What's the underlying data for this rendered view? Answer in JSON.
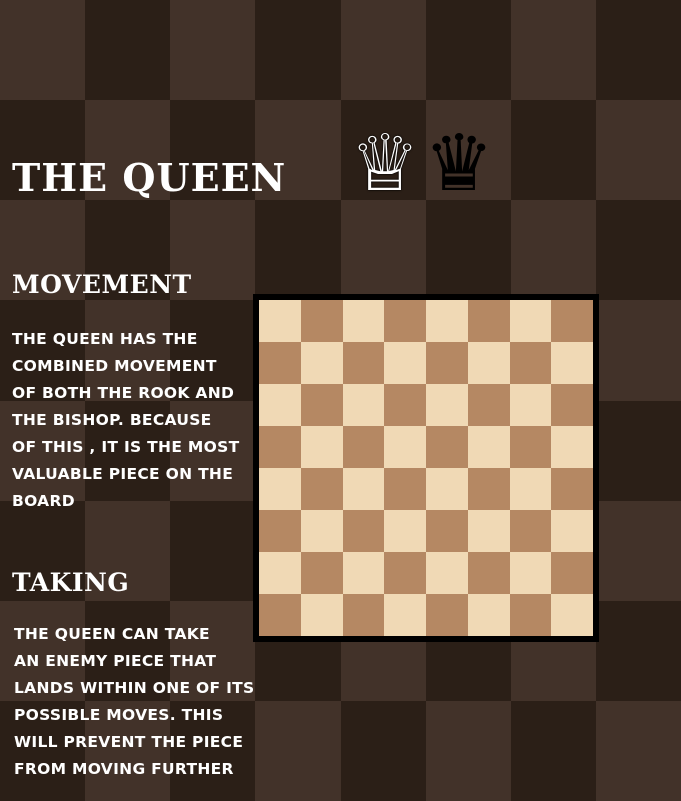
{
  "page": {
    "title": "The Queen"
  },
  "pieces": {
    "white_queen_glyph": "♕",
    "black_queen_glyph": "♛",
    "white_queen_icon": "white-queen-icon",
    "black_queen_icon": "black-queen-icon"
  },
  "sections": {
    "movement": {
      "heading": "Movement",
      "lines": [
        "The queen has the",
        "combined movement",
        "of both the rook and",
        "the bishop. because",
        "of this , it is the most",
        "valuable piece on the",
        "board"
      ]
    },
    "taking": {
      "heading": "Taking",
      "lines": [
        "The queen can take",
        "an enemy piece that",
        "lands within one of its",
        "possible moves. this",
        "will prevent the piece",
        "from moving further"
      ]
    }
  },
  "board": {
    "rows": 8,
    "cols": 8,
    "light_color": "#f0d9b5",
    "dark_color": "#b58863",
    "border_color": "#000000"
  },
  "background": {
    "light_color": "#423229",
    "dark_color": "#2b1f17"
  }
}
